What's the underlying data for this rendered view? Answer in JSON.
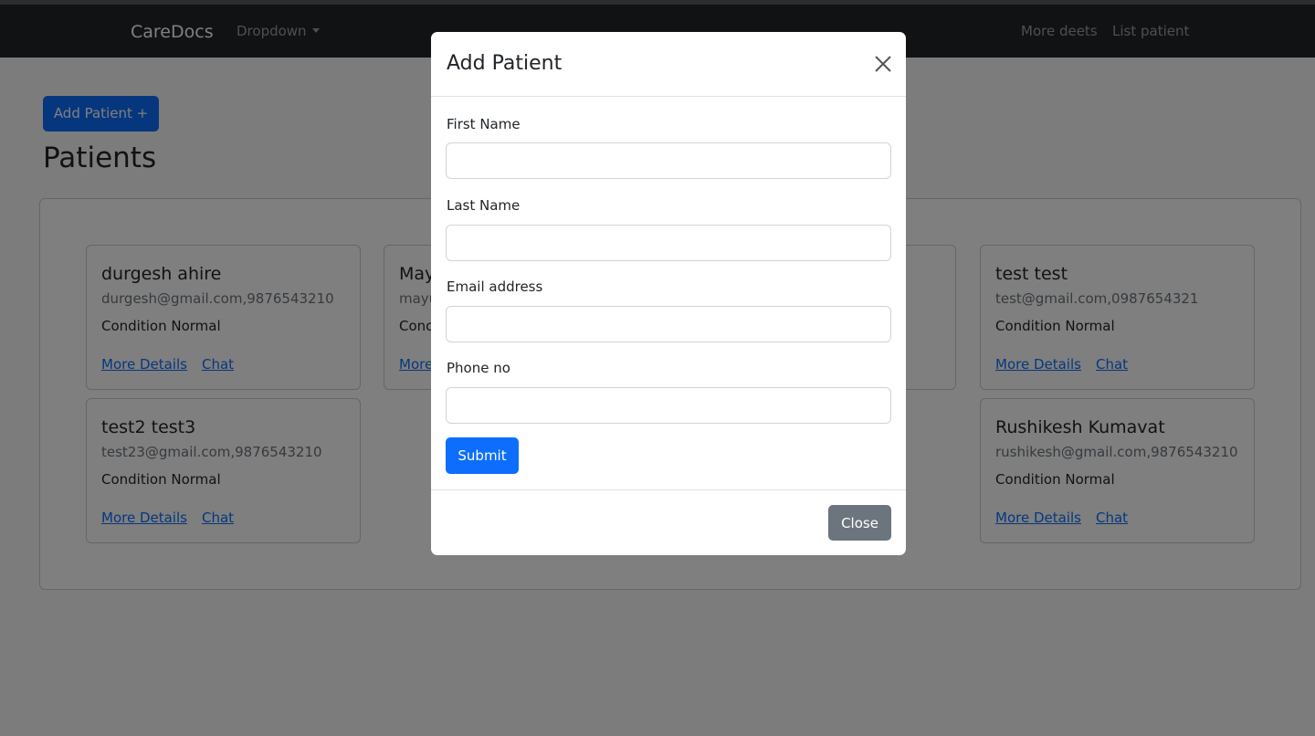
{
  "navbar": {
    "brand": "CareDocs",
    "dropdown": "Dropdown",
    "links": [
      "More deets",
      "List patient"
    ]
  },
  "page": {
    "add_button": "Add Patient +",
    "title": "Patients"
  },
  "cards": [
    {
      "name": "durgesh ahire",
      "contact": "durgesh@gmail.com,9876543210",
      "condition": "Condition Normal",
      "more": "More Details",
      "chat": "Chat"
    },
    {
      "name": "May",
      "contact": "mayu",
      "condition": "Conc",
      "more": "More",
      "chat": ""
    },
    {
      "name": "",
      "contact": "",
      "condition": "",
      "more": "",
      "chat": ""
    },
    {
      "name": "test test",
      "contact": "test@gmail.com,0987654321",
      "condition": "Condition Normal",
      "more": "More Details",
      "chat": "Chat"
    },
    {
      "name": "test2 test3",
      "contact": "test23@gmail.com,9876543210",
      "condition": "Condition Normal",
      "more": "More Details",
      "chat": "Chat"
    },
    {
      "name": "Rushikesh Kumavat",
      "contact": "rushikesh@gmail.com,9876543210",
      "condition": "Condition Normal",
      "more": "More Details",
      "chat": "Chat"
    }
  ],
  "modal": {
    "title": "Add Patient",
    "fields": [
      {
        "label": "First Name",
        "value": ""
      },
      {
        "label": "Last Name",
        "value": ""
      },
      {
        "label": "Email address",
        "value": ""
      },
      {
        "label": "Phone no",
        "value": ""
      }
    ],
    "submit": "Submit",
    "close": "Close"
  }
}
